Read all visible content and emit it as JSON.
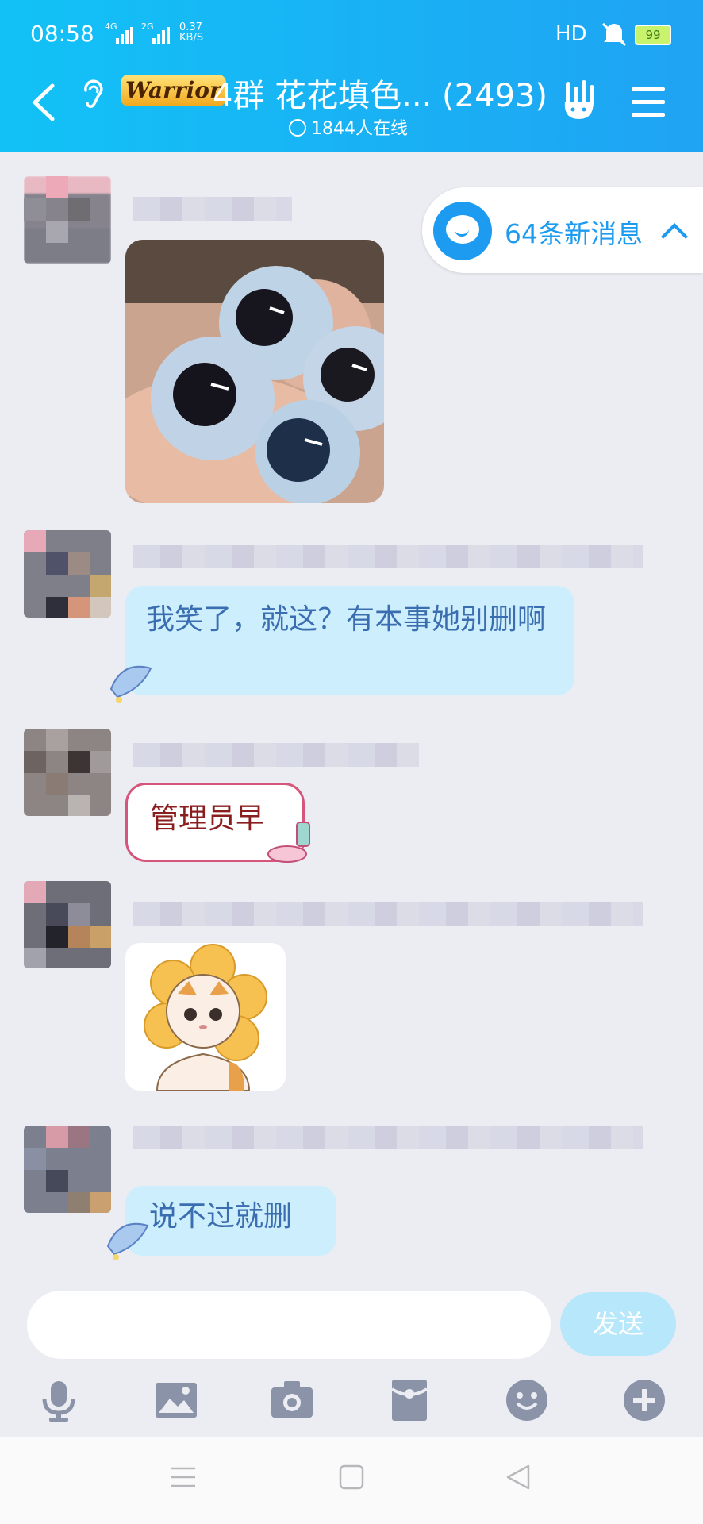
{
  "status_bar": {
    "time": "08:58",
    "net1": "4G",
    "net2": "2G",
    "speed_value": "0.37",
    "speed_unit": "KB/S",
    "hd": "HD",
    "battery": "99"
  },
  "header": {
    "badge": "Warrior",
    "title": "4群 花花填色...  (2493)",
    "online": "1844人在线"
  },
  "new_messages": {
    "label": "64条新消息"
  },
  "messages": [
    {
      "type": "image",
      "image": "eyeballs-meme"
    },
    {
      "type": "text",
      "text": "我笑了，就这？有本事她别删啊"
    },
    {
      "type": "text",
      "style": "admin",
      "text": "管理员早"
    },
    {
      "type": "image",
      "image": "flower-cat-sticker"
    },
    {
      "type": "text",
      "text": "说不过就删"
    }
  ],
  "composer": {
    "placeholder": "",
    "send_label": "发送"
  },
  "toolbar": [
    "microphone-icon",
    "image-icon",
    "camera-icon",
    "red-packet-icon",
    "emoji-icon",
    "plus-icon"
  ],
  "colors": {
    "header_start": "#12c2f6",
    "header_end": "#1fa3f3",
    "bubble": "#cdeefc",
    "bubble_text": "#3a6eb0",
    "accent": "#1c9bf0",
    "send_button": "#b7e7fb",
    "chat_background": "#ecedf3"
  }
}
